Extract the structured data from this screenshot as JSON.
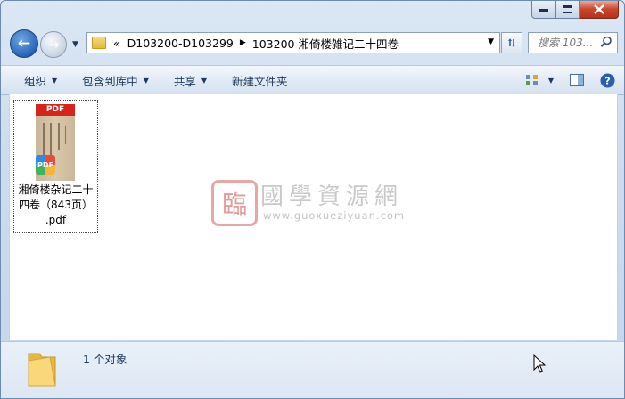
{
  "window": {
    "caption_buttons": {
      "minimize": "minimize",
      "maximize": "maximize",
      "close": "close"
    }
  },
  "nav": {
    "address": {
      "overflow_glyph": "«",
      "crumbs": [
        "D103200-D103299",
        "103200 湘倚楼雑记二十四卷"
      ]
    },
    "search_placeholder": "搜索 103..."
  },
  "toolbar": {
    "organize": "组织",
    "include_in_library": "包含到库中",
    "share": "共享",
    "new_folder": "新建文件夹"
  },
  "file": {
    "name_lines": [
      "湘倚楼杂记二十",
      "四卷（843页）",
      ".pdf"
    ],
    "thumb_label": "PDF",
    "badge_label": "PDF"
  },
  "watermark": {
    "seal": "臨",
    "title": "國學資源網",
    "url": "www.guoxueziyuan.com"
  },
  "status": {
    "text": "1 个对象"
  },
  "colors": {
    "accent": "#1e395b",
    "close_red": "#c9452d",
    "pdf_red": "#d6231c"
  }
}
